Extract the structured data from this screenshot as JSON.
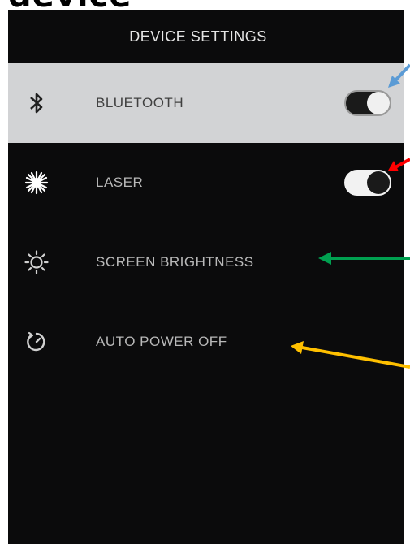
{
  "doc_fragment": "device",
  "header": {
    "title": "DEVICE SETTINGS"
  },
  "settings": [
    {
      "label": "BLUETOOTH",
      "icon": "bluetooth-icon",
      "has_toggle": true,
      "toggle_state": "on",
      "selected": true
    },
    {
      "label": "LASER",
      "icon": "laser-icon",
      "has_toggle": true,
      "toggle_state": "on",
      "selected": false
    },
    {
      "label": "SCREEN BRIGHTNESS",
      "icon": "brightness-icon",
      "has_toggle": false,
      "selected": false
    },
    {
      "label": "AUTO POWER OFF",
      "icon": "power-timer-icon",
      "has_toggle": false,
      "selected": false
    }
  ],
  "annotation_arrows": [
    {
      "target": "bluetooth-toggle",
      "color": "#5b9bd5"
    },
    {
      "target": "laser-toggle",
      "color": "#ff0000"
    },
    {
      "target": "screen-brightness-label",
      "color": "#00a050"
    },
    {
      "target": "auto-power-off-label",
      "color": "#ffc000"
    }
  ],
  "colors": {
    "screen_bg": "#0b0b0c",
    "selected_row_bg": "#d2d3d5",
    "label_text": "#b9b9b9",
    "selected_label_text": "#404040"
  }
}
